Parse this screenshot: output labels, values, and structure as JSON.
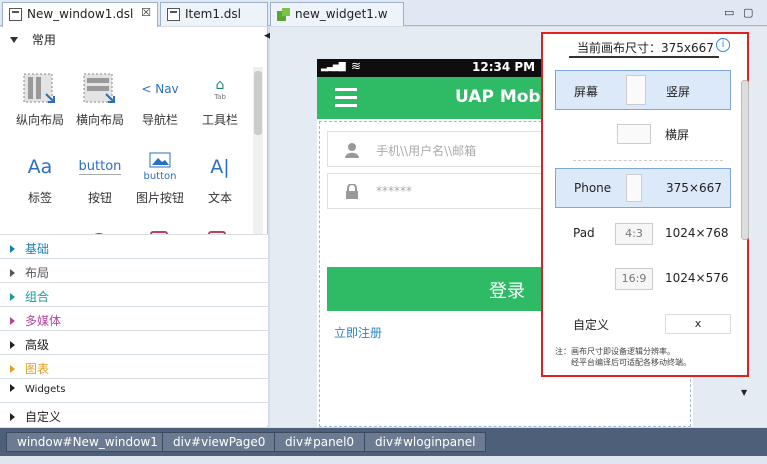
{
  "tabs": [
    {
      "label": "New_window1.dsl",
      "active": true,
      "close": "☒"
    },
    {
      "label": "Item1.dsl",
      "active": false
    },
    {
      "label": "new_widget1.w",
      "active": false
    }
  ],
  "palette": {
    "section_title": "常用",
    "items": [
      {
        "label": "纵向布局",
        "icon": "vertical-layout-icon"
      },
      {
        "label": "横向布局",
        "icon": "horizontal-layout-icon"
      },
      {
        "label": "导航栏",
        "icon": "navbar-icon",
        "icon_text": "Nav"
      },
      {
        "label": "工具栏",
        "icon": "toolbar-icon",
        "icon_text": "Tab"
      },
      {
        "label": "标签",
        "icon": "label-icon",
        "icon_text": "Aa"
      },
      {
        "label": "按钮",
        "icon": "button-icon",
        "icon_text": "button"
      },
      {
        "label": "图片按钮",
        "icon": "image-button-icon",
        "icon_text": "button"
      },
      {
        "label": "文本",
        "icon": "text-icon",
        "icon_text": "A|"
      }
    ],
    "categories": [
      {
        "label": "基础",
        "color": "#1a7fb0"
      },
      {
        "label": "布局",
        "color": "#555555"
      },
      {
        "label": "组合",
        "color": "#1a9a9a"
      },
      {
        "label": "多媒体",
        "color": "#b0489a"
      },
      {
        "label": "高级",
        "color": "#222222"
      },
      {
        "label": "图表",
        "color": "#e0a020"
      },
      {
        "label": "Widgets",
        "color": "#222222"
      },
      {
        "label": "自定义",
        "color": "#222222"
      }
    ]
  },
  "phone": {
    "time": "12:34 PM",
    "title": "UAP Mobile",
    "username_placeholder": "手机\\\\用户名\\\\邮箱",
    "password_placeholder": "******",
    "login_label": "登录",
    "register_link": "立即注册"
  },
  "canvas_size_panel": {
    "title": "当前画布尺寸：375x667",
    "info_icon": "i",
    "screen_label": "屏幕",
    "portrait_label": "竖屏",
    "landscape_label": "横屏",
    "phone_label": "Phone",
    "phone_size": "375×667",
    "pad_label": "Pad",
    "pad_ratio_1": "4:3",
    "pad_size_1": "1024×768",
    "pad_ratio_2": "16:9",
    "pad_size_2": "1024×576",
    "custom_label": "自定义",
    "custom_value": "x",
    "note_line1": "注：画布尺寸即设备逻辑分辨率。",
    "note_line2": "经平台编译后可适配各移动终端。"
  },
  "breadcrumb": [
    "window#New_window1",
    "div#viewPage0",
    "div#panel0",
    "div#wloginpanel"
  ],
  "colors": {
    "accent_green": "#2fbb66",
    "highlight_border": "#e02020",
    "link_blue": "#2b86c6"
  }
}
